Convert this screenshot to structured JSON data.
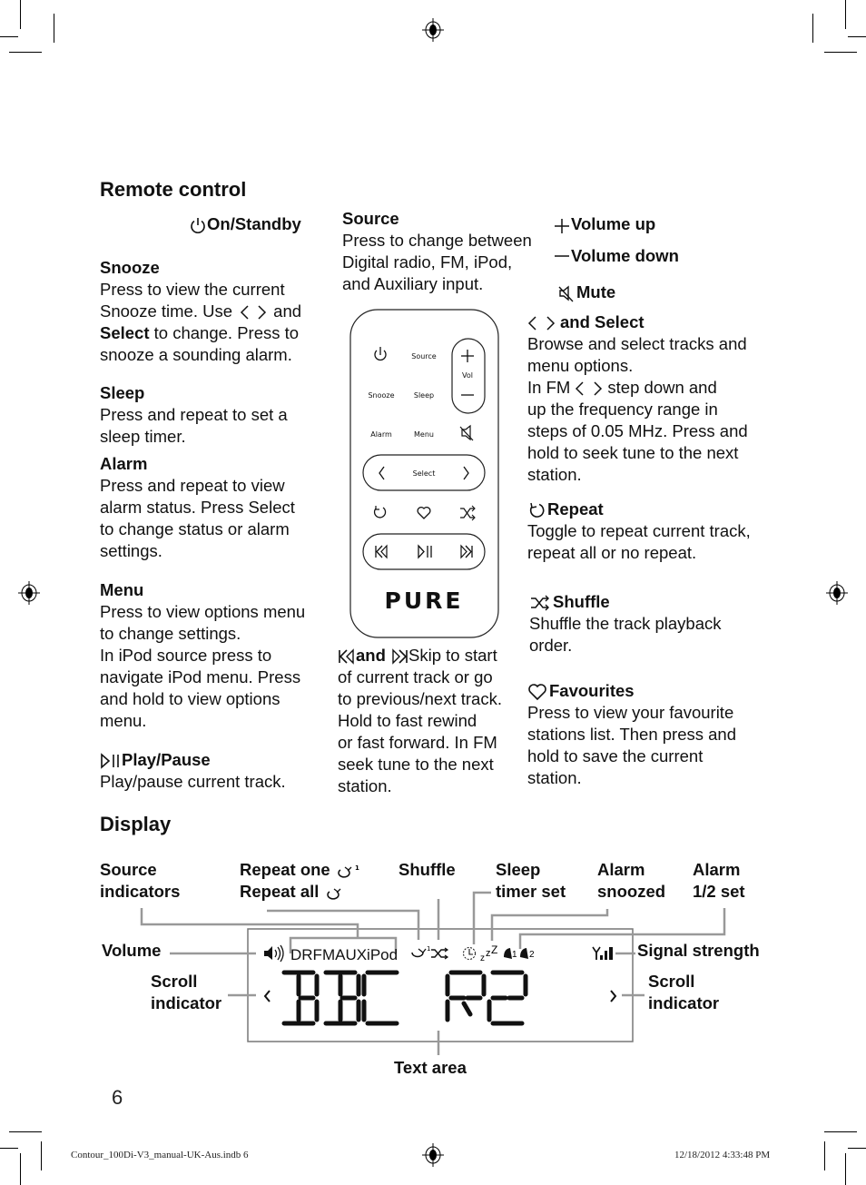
{
  "page": {
    "page_number": "6",
    "footer_file": "Contour_100Di-V3_manual-UK-Aus.indb  6",
    "footer_timestamp": "12/18/2012   4:33:48 PM"
  },
  "remote_section": {
    "title": "Remote control",
    "on_standby": {
      "icon": "power-icon",
      "label": "On/Standby"
    },
    "snooze": {
      "title": "Snooze",
      "line1": "Press to view the current",
      "line2_pre": "Snooze time. Use",
      "line2_post": "and",
      "line3_bold": "Select",
      "line3_rest": " to change. Press to",
      "line4": "snooze a sounding alarm."
    },
    "sleep": {
      "title": "Sleep",
      "lines": [
        "Press and repeat to set a",
        "sleep timer."
      ]
    },
    "alarm": {
      "title": "Alarm",
      "lines": [
        "Press and repeat to view",
        "alarm status. Press Select",
        "to change status or alarm",
        "settings."
      ]
    },
    "menu": {
      "title": "Menu",
      "lines": [
        "Press to view options menu",
        "to change settings.",
        "In iPod source press to",
        "navigate iPod menu. Press",
        "and hold to view options",
        "menu."
      ]
    },
    "play_pause": {
      "icon": "play-pause-icon",
      "title": "Play/Pause",
      "lines": [
        "Play/pause current track."
      ]
    },
    "source": {
      "title": "Source",
      "lines": [
        "Press to change between",
        "Digital radio, FM, iPod,",
        "and Auxiliary input."
      ]
    },
    "skip": {
      "icon_prev": "skip-back-icon",
      "icon_next": "skip-forward-icon",
      "and": "and",
      "first": "Skip to start",
      "lines": [
        "of current track or go",
        "to previous/next track.",
        "Hold to fast rewind",
        "or fast forward. In FM",
        "seek tune to the next",
        "station."
      ]
    },
    "volume_up": {
      "icon": "plus-icon",
      "label": "Volume up"
    },
    "volume_down": {
      "icon": "minus-icon",
      "label": "Volume down"
    },
    "mute": {
      "icon": "mute-icon",
      "label": "Mute"
    },
    "select": {
      "title": "and Select",
      "lines": [
        "Browse and select tracks and",
        "menu options."
      ],
      "fm_pre": "In FM",
      "fm_post": "step down and",
      "more_lines": [
        "up the frequency range in",
        "steps of 0.05 MHz. Press and",
        "hold to seek tune to the next",
        "station."
      ]
    },
    "repeat": {
      "icon": "repeat-icon",
      "title": "Repeat",
      "lines": [
        "Toggle to repeat current track,",
        "repeat all or no repeat."
      ]
    },
    "shuffle": {
      "icon": "shuffle-icon",
      "title": "Shuffle",
      "lines": [
        "Shuffle the track playback",
        "order."
      ]
    },
    "favourites": {
      "icon": "heart-icon",
      "title": "Favourites",
      "lines": [
        "Press to view your favourite",
        "stations list. Then press and",
        "hold to save the current",
        "station."
      ]
    }
  },
  "remote_device": {
    "buttons": {
      "source": "Source",
      "vol": "Vol",
      "snooze": "Snooze",
      "sleep": "Sleep",
      "alarm": "Alarm",
      "menu": "Menu",
      "select": "Select"
    },
    "brand": "PURE"
  },
  "display_section": {
    "title": "Display",
    "labels": {
      "source_indicators": [
        "Source",
        "indicators"
      ],
      "repeat_one": "Repeat one",
      "repeat_all": "Repeat all",
      "shuffle": "Shuffle",
      "sleep_timer": [
        "Sleep",
        "timer set"
      ],
      "alarm_snoozed": [
        "Alarm",
        "snoozed"
      ],
      "alarm_set": [
        "Alarm",
        "1/2 set"
      ],
      "volume": "Volume",
      "signal_strength": "Signal strength",
      "scroll_left": [
        "Scroll",
        "indicator"
      ],
      "scroll_right": [
        "Scroll",
        "indicator"
      ],
      "text_area": "Text area"
    },
    "lcd": {
      "sources": "DRFMAUXiPod",
      "repeat_sup": "1",
      "snooze_text": "zZ",
      "alarm1": "1",
      "alarm2": "2",
      "text": "BBC R2"
    }
  }
}
